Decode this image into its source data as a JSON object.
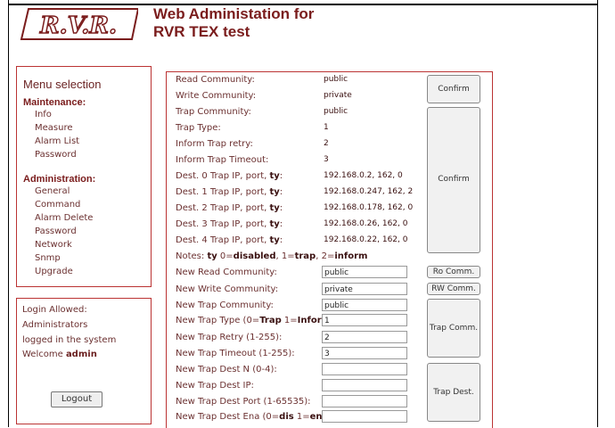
{
  "header": {
    "logo_text": "R.V.R.",
    "title_line1": "Web Administation for",
    "title_line2": "RVR TEX test"
  },
  "menu": {
    "title": "Menu selection",
    "maintenance_heading": "Maintenance:",
    "maintenance_items": [
      "Info",
      "Measure",
      "Alarm List",
      "Password"
    ],
    "administration_heading": "Administration:",
    "administration_items": [
      "General",
      "Command",
      "Alarm Delete",
      "Password",
      "Network",
      "Snmp",
      "Upgrade"
    ]
  },
  "login": {
    "line1": "Login Allowed:",
    "line2": "Administrators",
    "line3": "logged in the system",
    "welcome": "Welcome",
    "user": "admin",
    "logout_label": "Logout"
  },
  "snmp_info": {
    "rows": [
      {
        "label": "Read Community:",
        "value": "public"
      },
      {
        "label": "Write Community:",
        "value": "private"
      },
      {
        "label": "Trap Community:",
        "value": "public"
      },
      {
        "label": "Trap Type:",
        "value": "1"
      },
      {
        "label": "Inform Trap retry:",
        "value": "2"
      },
      {
        "label": "Inform Trap Timeout:",
        "value": "3"
      }
    ],
    "dest_rows": [
      {
        "label": "Dest. 0 Trap IP, port, ",
        "ty": "ty",
        "sep": ":",
        "value": "192.168.0.2, 162, 0"
      },
      {
        "label": "Dest. 1 Trap IP, port, ",
        "ty": "ty",
        "sep": ":",
        "value": "192.168.0.247, 162, 2"
      },
      {
        "label": "Dest. 2 Trap IP, port, ",
        "ty": "ty",
        "sep": ":",
        "value": "192.168.0.178, 162, 0"
      },
      {
        "label": "Dest. 3 Trap IP, port, ",
        "ty": "ty",
        "sep": ":",
        "value": "192.168.0.26, 162, 0"
      },
      {
        "label": "Dest. 4 Trap IP, port, ",
        "ty": "ty",
        "sep": ":",
        "value": "192.168.0.22, 162, 0"
      }
    ],
    "notes": {
      "prefix": "Notes: ",
      "ty": "ty",
      "zero": " 0=",
      "disabled": "disabled",
      "one": ", 1=",
      "trap": "trap",
      "two": ", 2=",
      "inform": "inform"
    }
  },
  "form": {
    "new_read_label": "New Read Community:",
    "new_read_value": "public",
    "new_write_label": "New Write Community:",
    "new_write_value": "private",
    "new_trap_comm_label": "New Trap Community:",
    "new_trap_comm_value": "public",
    "new_trap_type_prefix": "New Trap Type (0=",
    "new_trap_type_trap": "Trap",
    "new_trap_type_mid": " 1=",
    "new_trap_type_inform": "Inform",
    "new_trap_type_suffix": ")",
    "new_trap_type_value": "1",
    "new_trap_retry_label": "New Trap Retry (1-255):",
    "new_trap_retry_value": "2",
    "new_trap_timeout_label": "New Trap Timeout (1-255):",
    "new_trap_timeout_value": "3",
    "new_trap_dest_n_label": "New Trap Dest N (0-4):",
    "new_trap_dest_n_value": "",
    "new_trap_dest_ip_label": "New Trap Dest IP:",
    "new_trap_dest_ip_value": "",
    "new_trap_dest_port_label": "New Trap Dest Port (1-65535):",
    "new_trap_dest_port_value": "",
    "new_trap_dest_ena_prefix": "New Trap Dest Ena (0=",
    "new_trap_dest_ena_dis": "dis",
    "new_trap_dest_ena_mid": " 1=",
    "new_trap_dest_ena_en": "en",
    "new_trap_dest_ena_suffix": "):",
    "new_trap_dest_ena_value": ""
  },
  "buttons": {
    "confirm_top": "Confirm",
    "confirm_mid": "Confirm",
    "ro_comm": "Ro Comm.",
    "rw_comm": "RW Comm.",
    "trap_comm": "Trap Comm.",
    "trap_dest": "Trap Dest."
  },
  "colors": {
    "accent": "#7a1c1c",
    "border": "#bb3333"
  }
}
